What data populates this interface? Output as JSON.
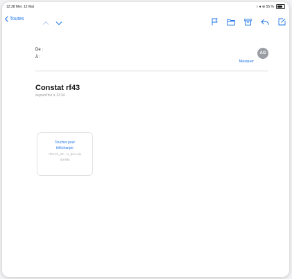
{
  "status_bar": {
    "time_date": "12:38  Mer. 12 Mai",
    "indicators": "○ ● ⊕ 55 %"
  },
  "toolbar": {
    "back_label": "Toutes",
    "icons": [
      "flag-icon",
      "folder-icon",
      "archive-icon",
      "reply-icon",
      "compose-icon"
    ]
  },
  "message": {
    "from_label": "De :",
    "to_label": "À :",
    "more_link": "Masquer",
    "avatar_initials": "AG",
    "subject": "Constat rf43",
    "date": "aujourd'hui à 12:34"
  },
  "attachment": {
    "action_line1": "Toucher pour",
    "action_line2": "télécharger",
    "filename": "rf43-21_26...cr_fpcs.zip",
    "size": "4,8 Mo"
  },
  "colors": {
    "accent": "#1a73e8",
    "background": "#ffffff"
  }
}
